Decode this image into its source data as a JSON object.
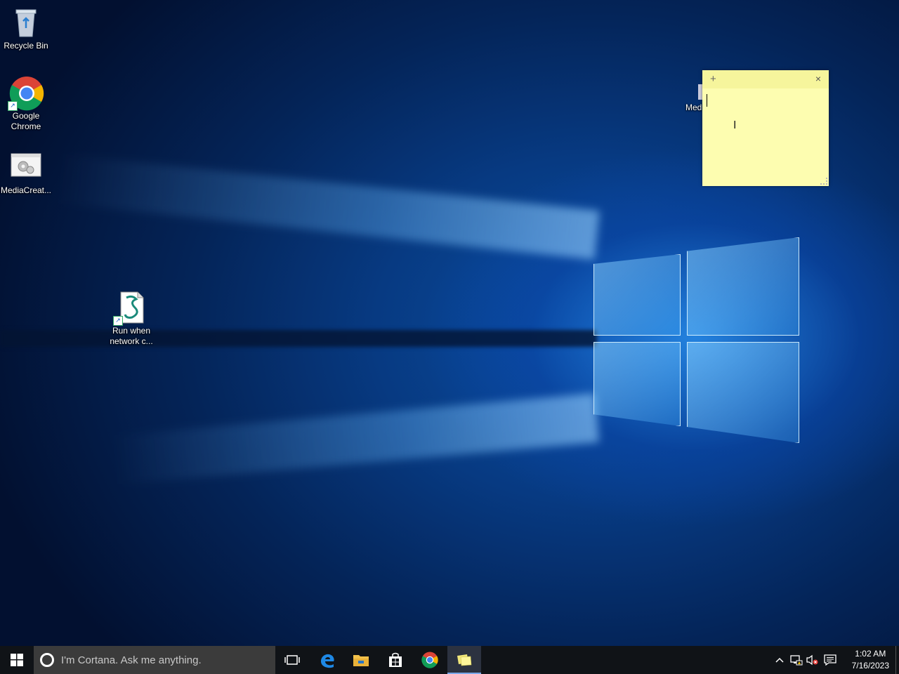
{
  "desktop": {
    "icons": [
      {
        "label": "Recycle Bin",
        "icon": "recycle-bin-icon"
      },
      {
        "label": "Google Chrome",
        "icon": "chrome-icon"
      },
      {
        "label": "MediaCreat...",
        "icon": "media-creation-tool-icon"
      },
      {
        "label": "Run when network c...",
        "icon": "script-icon"
      },
      {
        "label": "Med",
        "icon": "media-creation-tool-icon"
      }
    ]
  },
  "sticky_note": {
    "add_label": "+",
    "close_label": "×",
    "content": ""
  },
  "taskbar": {
    "search_placeholder": "I'm Cortana. Ask me anything.",
    "apps": [
      "task-view-icon",
      "edge-icon",
      "file-explorer-icon",
      "store-icon",
      "chrome-icon",
      "sticky-notes-icon"
    ],
    "tray": {
      "time": "1:02 AM",
      "date": "7/16/2023",
      "icons": [
        "chevron-up-icon",
        "network-icon",
        "volume-muted-icon",
        "action-center-icon"
      ]
    }
  },
  "colors": {
    "sticky_bg": "#fdfdb0",
    "taskbar_bg": "#101317",
    "search_bg": "#3b3b3b"
  }
}
